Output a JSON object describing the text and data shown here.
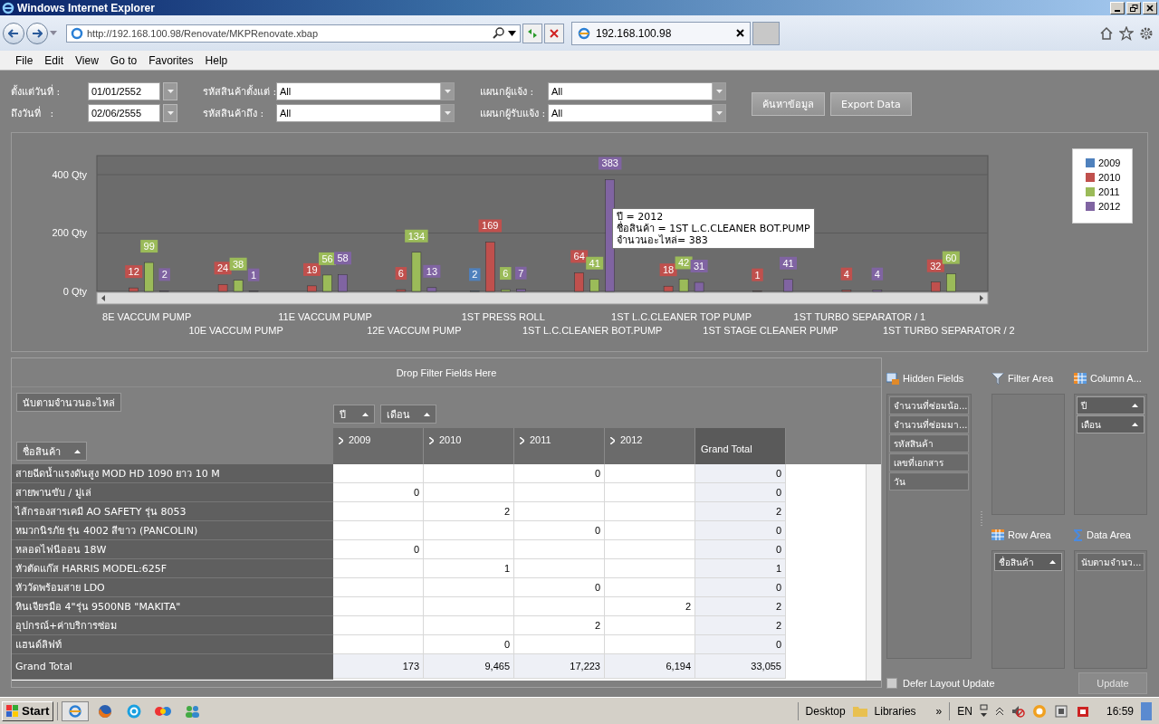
{
  "window": {
    "title": "Windows Internet Explorer"
  },
  "address_bar": {
    "url": "http://192.168.100.98/Renovate/MKPRenovate.xbap"
  },
  "tabs": [
    {
      "label": "192.168.100.98",
      "selected": true
    }
  ],
  "menu": [
    "File",
    "Edit",
    "View",
    "Go to",
    "Favorites",
    "Help"
  ],
  "filters": [
    {
      "label": "ตั้งแต่วันที่ :",
      "value": "01/01/2552",
      "kind": "date"
    },
    {
      "label": "ถึงวันที่   :",
      "value": "02/06/2555",
      "kind": "date"
    },
    {
      "label": "รหัสสินค้าตั้งแต่ :",
      "value": "All",
      "kind": "combo"
    },
    {
      "label": "รหัสสินค้าถึง :",
      "value": "All",
      "kind": "combo"
    },
    {
      "label": "แผนกผู้แจ้ง :",
      "value": "All",
      "kind": "combo"
    },
    {
      "label": "แผนกผู้รับแจ้ง :",
      "value": "All",
      "kind": "combo"
    }
  ],
  "buttons": [
    "ค้นหาข้อมูล",
    "Export Data"
  ],
  "chart": {
    "chart_data": {
      "type": "bar",
      "categories": [
        "8E VACCUM PUMP",
        "10E VACCUM PUMP",
        "11E VACCUM PUMP",
        "12E VACCUM PUMP",
        "1ST PRESS ROLL",
        "1ST L.C.CLEANER BOT.PUMP",
        "1ST L.C.CLEANER TOP PUMP",
        "1ST STAGE CLEANER PUMP",
        "1ST TURBO SEPARATOR / 1",
        "1ST TURBO SEPARATOR / 2"
      ],
      "series": [
        {
          "name": "2009",
          "color": "#4f81bd",
          "values": [
            null,
            null,
            null,
            null,
            2,
            null,
            null,
            null,
            null,
            null
          ]
        },
        {
          "name": "2010",
          "color": "#c0504d",
          "values": [
            12,
            24,
            19,
            6,
            169,
            64,
            18,
            1,
            4,
            32
          ]
        },
        {
          "name": "2011",
          "color": "#9bbb59",
          "values": [
            99,
            38,
            56,
            134,
            6,
            41,
            42,
            null,
            null,
            60
          ]
        },
        {
          "name": "2012",
          "color": "#8064a2",
          "values": [
            2,
            1,
            58,
            13,
            7,
            383,
            31,
            41,
            4,
            null
          ]
        }
      ],
      "ylim": [
        0,
        465
      ],
      "yticks": [
        {
          "value": 0,
          "label": "0 Qty"
        },
        {
          "value": 200,
          "label": "200 Qty"
        },
        {
          "value": 400,
          "label": "400 Qty"
        }
      ],
      "data_labels": true
    },
    "tooltip": [
      "ปี = 2012",
      "ชื่อสินค้า = 1ST L.C.CLEANER BOT.PUMP",
      "จำนวนอะไหล่= 383"
    ]
  },
  "pivot": {
    "filter_hint": "Drop Filter Fields Here",
    "data_field": "นับตามจำนวนอะไหล่",
    "column_fields": [
      "ปี",
      "เดือน"
    ],
    "row_field": "ชื่อสินค้า",
    "columns": [
      "2009",
      "2010",
      "2011",
      "2012"
    ],
    "grand_total_header": "Grand Total",
    "rows": [
      {
        "label": "สายฉีดน้ำแรงดันสูง MOD HD 1090 ยาว 10 M",
        "cells": [
          null,
          null,
          "0",
          null
        ],
        "total": "0"
      },
      {
        "label": "สายพานขับ / มู่เล่",
        "cells": [
          "0",
          null,
          null,
          null
        ],
        "total": "0"
      },
      {
        "label": "ไส้กรองสารเคมี AO SAFETY รุ่น 8053",
        "cells": [
          null,
          "2",
          null,
          null
        ],
        "total": "2"
      },
      {
        "label": "หมวกนิรภัย รุ่น 4002 สีขาว (PANCOLIN)",
        "cells": [
          null,
          null,
          "0",
          null
        ],
        "total": "0"
      },
      {
        "label": "หลอดไฟนีออน 18W",
        "cells": [
          "0",
          null,
          null,
          null
        ],
        "total": "0"
      },
      {
        "label": "หัวตัดแก๊ส HARRIS MODEL:625F",
        "cells": [
          null,
          "1",
          null,
          null
        ],
        "total": "1"
      },
      {
        "label": "หัววัดพร้อมสาย LDO",
        "cells": [
          null,
          null,
          "0",
          null
        ],
        "total": "0"
      },
      {
        "label": "หินเจียรมือ 4\"รุ่น 9500NB \"MAKITA\"",
        "cells": [
          null,
          null,
          null,
          "2"
        ],
        "total": "2"
      },
      {
        "label": "อุปกรณ์+ค่าบริการซ่อม",
        "cells": [
          null,
          null,
          "2",
          null
        ],
        "total": "2"
      },
      {
        "label": "แฮนด์ลิฟท์",
        "cells": [
          null,
          "0",
          null,
          null
        ],
        "total": "0"
      }
    ],
    "grand_total": {
      "label": "Grand Total",
      "cells": [
        "173",
        "9,465",
        "17,223",
        "6,194"
      ],
      "total": "33,055"
    }
  },
  "field_list": {
    "areas": [
      {
        "title": "Hidden Fields",
        "kind": "hidden",
        "fields": [
          {
            "label": "จำนวนที่ซ่อมน้อ...",
            "sortable": false
          },
          {
            "label": "จำนวนที่ซ่อมมา...",
            "sortable": false
          },
          {
            "label": "รหัสสินค้า",
            "sortable": false
          },
          {
            "label": "เลขที่เอกสาร",
            "sortable": false
          },
          {
            "label": "วัน",
            "sortable": false
          }
        ]
      },
      {
        "title": "Filter Area",
        "kind": "filter"
      },
      {
        "title": "Column A...",
        "kind": "column",
        "fields": [
          {
            "label": "ปี",
            "sortable": true
          },
          {
            "label": "เดือน",
            "sortable": true
          }
        ]
      },
      {
        "title": "Row Area",
        "kind": "row",
        "fields": [
          {
            "label": "ชื่อสินค้า",
            "sortable": true
          }
        ]
      },
      {
        "title": "Data Area",
        "kind": "data",
        "fields": [
          {
            "label": "นับตามจำนว...",
            "sortable": false
          }
        ]
      }
    ],
    "defer": {
      "label": "Defer Layout Update",
      "checked": false
    },
    "update": {
      "label": "Update",
      "disabled": true
    }
  },
  "taskbar": {
    "start": "Start",
    "desktop": "Desktop",
    "libraries": "Libraries",
    "overflow": "»",
    "language": "EN",
    "time": "16:59"
  }
}
